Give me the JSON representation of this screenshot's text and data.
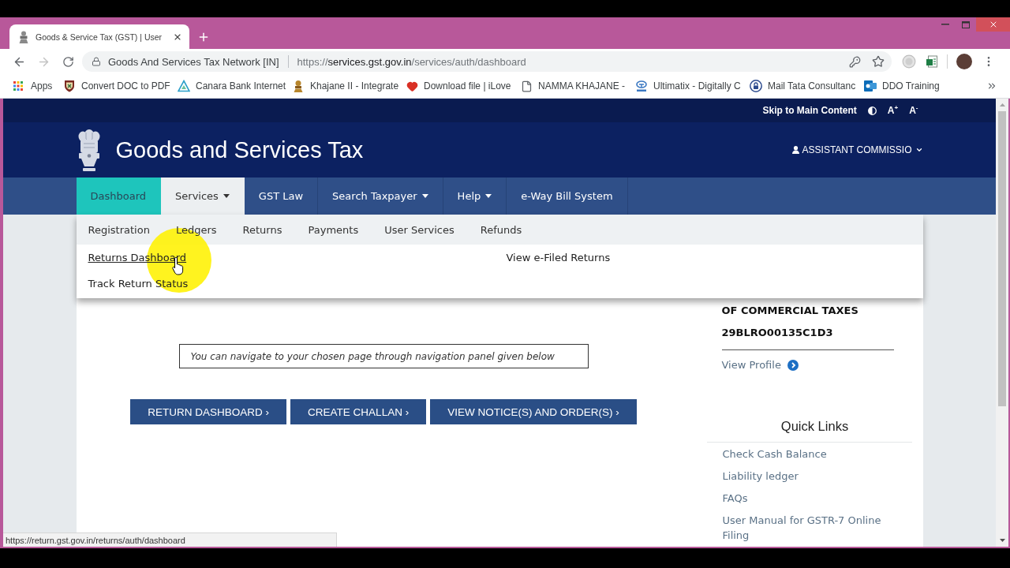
{
  "browser": {
    "tab": {
      "title": "Goods & Service Tax (GST) | User"
    },
    "forward_disabled": true,
    "address_bar": {
      "site_name": "Goods And Services Tax Network [IN]",
      "url_scheme": "https://",
      "url_host": "services.gst.gov.in",
      "url_path": "/services/auth/dashboard"
    },
    "bookmarks": [
      "Apps",
      "Convert DOC to PDF",
      "Canara Bank Internet",
      "Khajane II - Integrate",
      "Download file | iLove",
      "NAMMA KHAJANE -",
      "Ultimatix - Digitally C",
      "Mail Tata Consultanc",
      "DDO Training"
    ],
    "status_url": "https://return.gst.gov.in/returns/auth/dashboard"
  },
  "page": {
    "utility": {
      "skip": "Skip to Main Content",
      "font_increase": "A$^{+}$",
      "font_decrease": "A$^{-}$"
    },
    "site_title": "Goods and Services Tax",
    "user_menu": "ASSISTANT COMMISSIO",
    "nav": [
      {
        "label": "Dashboard",
        "selected": true,
        "expanded": false,
        "has_menu": false
      },
      {
        "label": "Services",
        "selected": false,
        "expanded": true,
        "has_menu": true
      },
      {
        "label": "GST Law",
        "selected": false,
        "expanded": false,
        "has_menu": false
      },
      {
        "label": "Search Taxpayer",
        "selected": false,
        "expanded": false,
        "has_menu": true
      },
      {
        "label": "Help",
        "selected": false,
        "expanded": false,
        "has_menu": true
      },
      {
        "label": "e-Way Bill System",
        "selected": false,
        "expanded": false,
        "has_menu": false
      }
    ],
    "services_menu": {
      "categories": [
        "Registration",
        "Ledgers",
        "Returns",
        "Payments",
        "User Services",
        "Refunds"
      ],
      "links": [
        {
          "label": "Returns Dashboard",
          "hovered": true
        },
        {
          "label": "View e-Filed Returns",
          "hovered": false
        },
        {
          "label": "Track Return Status",
          "hovered": false
        }
      ]
    },
    "profile": {
      "lines": [
        "OF COMMERCIAL TAXES",
        "29BLRO00135C1D3"
      ],
      "link": "View Profile"
    },
    "notice": "You can navigate to your chosen page through navigation panel given below",
    "actions": [
      "RETURN DASHBOARD ›",
      "CREATE CHALLAN ›",
      "VIEW NOTICE(S) AND ORDER(S) ›"
    ],
    "quick_links": {
      "title": "Quick Links",
      "items": [
        "Check Cash Balance",
        "Liability ledger",
        "FAQs",
        "User Manual for GSTR-7 Online Filing"
      ]
    }
  }
}
